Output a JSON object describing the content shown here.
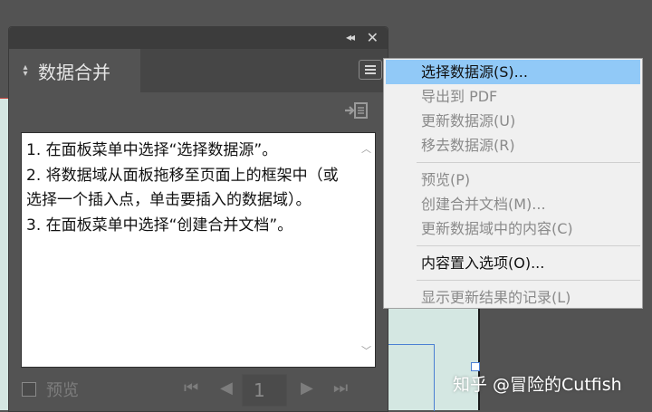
{
  "panel": {
    "tab_title": "数据合并",
    "instructions": [
      "1. 在面板菜单中选择“选择数据源”。",
      "2. 将数据域从面板拖移至页面上的框架中（或选择一个插入点，单击要插入的数据域）。",
      "3. 在面板菜单中选择“创建合并文档”。"
    ],
    "preview_label": "预览",
    "page_number": "1"
  },
  "menu": {
    "items": [
      {
        "label": "选择数据源(S)...",
        "enabled": true,
        "highlighted": true
      },
      {
        "label": "导出到 PDF",
        "enabled": false
      },
      {
        "label": "更新数据源(U)",
        "enabled": false
      },
      {
        "label": "移去数据源(R)",
        "enabled": false
      },
      {
        "label": "预览(P)",
        "enabled": false
      },
      {
        "label": "创建合并文档(M)...",
        "enabled": false
      },
      {
        "label": "更新数据域中的内容(C)",
        "enabled": false
      },
      {
        "label": "内容置入选项(O)...",
        "enabled": true
      },
      {
        "label": "显示更新结果的记录(L)",
        "enabled": false
      }
    ]
  },
  "watermark": "知乎 @冒险的Cutfish",
  "icons": [
    "collapse-icon",
    "close-icon",
    "panel-menu-icon",
    "place-field-icon",
    "first-page-icon",
    "prev-page-icon",
    "next-page-icon",
    "last-page-icon"
  ],
  "colors": {
    "highlight": "#91c9f7",
    "panel_bg": "#535353",
    "menu_bg": "#f0f0f0"
  }
}
